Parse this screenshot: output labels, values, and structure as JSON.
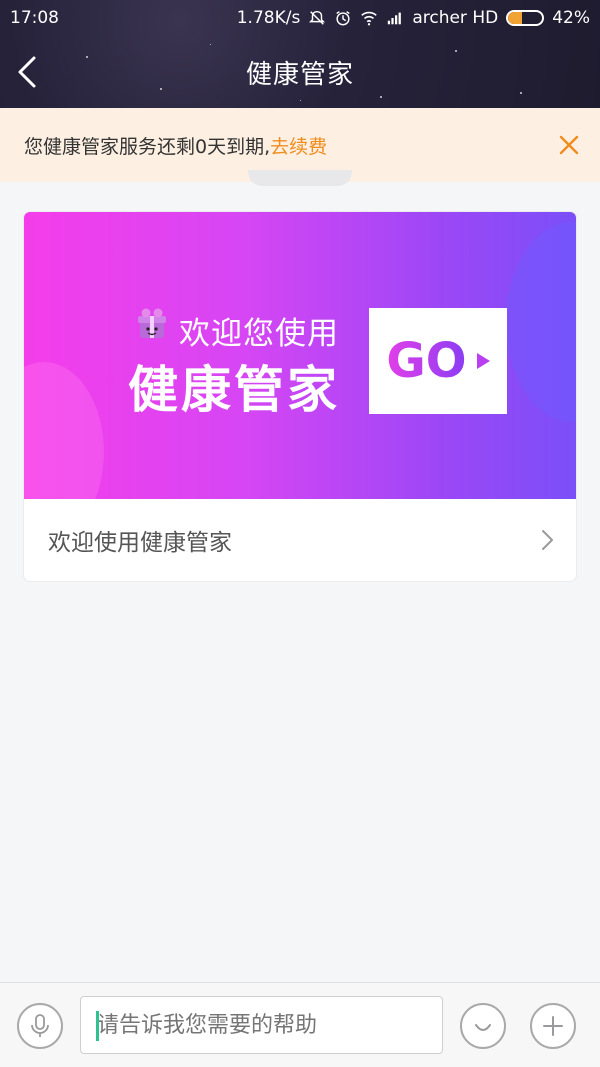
{
  "status_bar": {
    "time": "17:08",
    "network_speed": "1.78K/s",
    "carrier": "archer HD",
    "battery_percent_text": "42%",
    "battery_level": 0.42
  },
  "nav": {
    "title": "健康管家",
    "back_icon": "chevron-left-icon"
  },
  "notice": {
    "message": "您健康管家服务还剩0天到期,",
    "link": "去续费",
    "link_color": "#f08c1d",
    "close_icon": "close-icon"
  },
  "card": {
    "banner": {
      "line1": "欢迎您使用",
      "line2": "健康管家",
      "button": "GO",
      "gradient_start": "#f53dea",
      "gradient_end": "#7b4ff8"
    },
    "row_label": "欢迎使用健康管家"
  },
  "input_bar": {
    "placeholder": "请告诉我您需要的帮助",
    "voice_icon": "microphone-icon",
    "emoji_icon": "smiley-icon",
    "add_icon": "plus-icon"
  }
}
